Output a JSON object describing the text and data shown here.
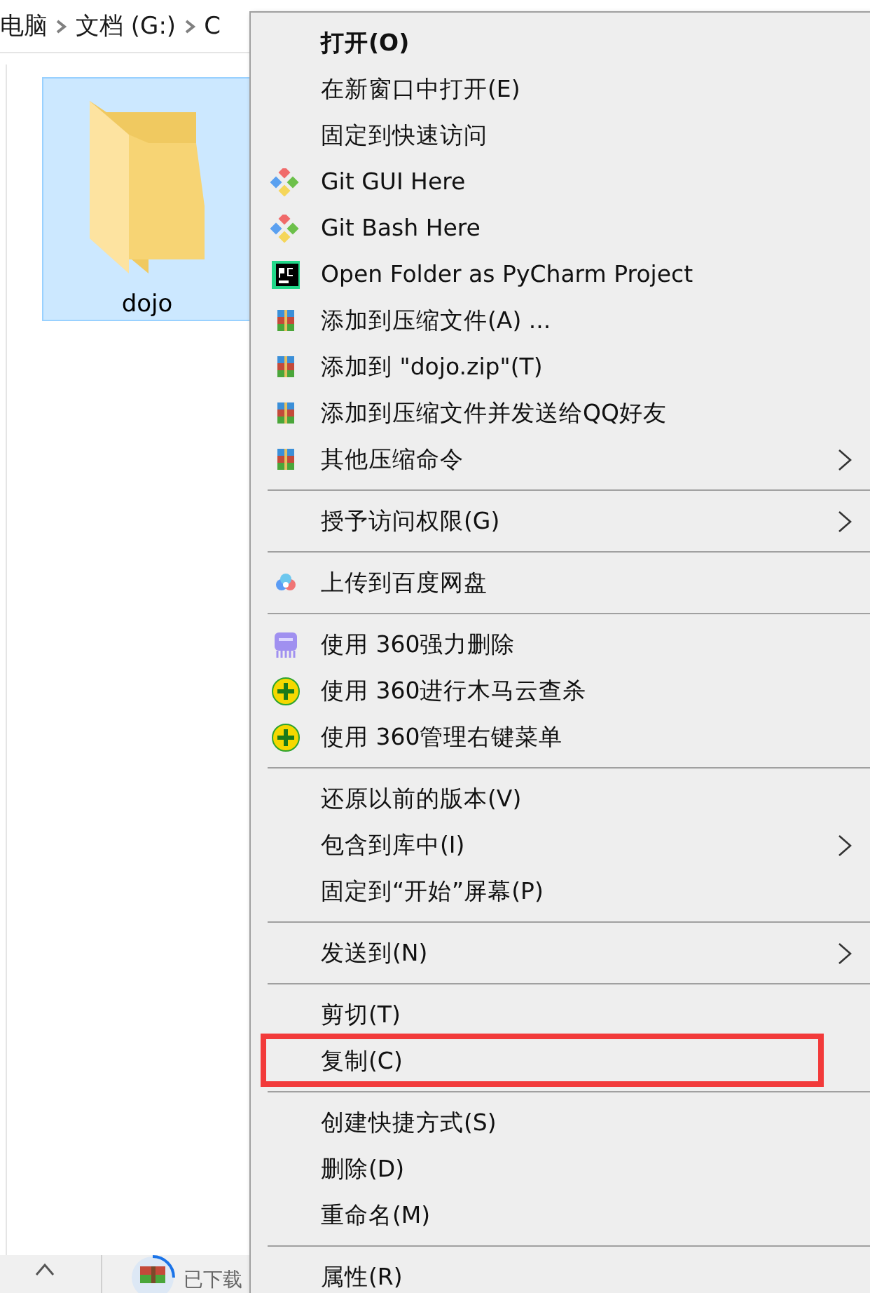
{
  "explorer": {
    "breadcrumb": [
      "电脑",
      "文档 (G:)",
      "C"
    ],
    "folder": {
      "name": "dojo",
      "selected": true
    }
  },
  "taskbar": {
    "download": {
      "status": "已下载"
    }
  },
  "menu": {
    "items": [
      {
        "kind": "plain",
        "label": "打开(O)",
        "bold": true
      },
      {
        "kind": "plain",
        "label": "在新窗口中打开(E)"
      },
      {
        "kind": "plain",
        "label": "固定到快速访问"
      },
      {
        "kind": "git",
        "label": "Git GUI Here"
      },
      {
        "kind": "git",
        "label": "Git Bash Here"
      },
      {
        "kind": "pycharm",
        "label": "Open Folder as PyCharm Project"
      },
      {
        "kind": "archive",
        "label": "添加到压缩文件(A) ..."
      },
      {
        "kind": "archive",
        "label": "添加到 \"dojo.zip\"(T)"
      },
      {
        "kind": "archive",
        "label": "添加到压缩文件并发送给QQ好友"
      },
      {
        "kind": "archive",
        "label": "其他压缩命令",
        "submenu": true
      },
      {
        "kind": "separator"
      },
      {
        "kind": "plain",
        "label": "授予访问权限(G)",
        "submenu": true
      },
      {
        "kind": "separator"
      },
      {
        "kind": "cloud",
        "label": "上传到百度网盘"
      },
      {
        "kind": "separator"
      },
      {
        "kind": "shredder",
        "label": "使用 360强力删除"
      },
      {
        "kind": "plus",
        "label": "使用 360进行木马云查杀"
      },
      {
        "kind": "plus",
        "label": "使用 360管理右键菜单"
      },
      {
        "kind": "separator"
      },
      {
        "kind": "plain",
        "label": "还原以前的版本(V)"
      },
      {
        "kind": "plain",
        "label": "包含到库中(I)",
        "submenu": true
      },
      {
        "kind": "plain",
        "label": "固定到“开始”屏幕(P)"
      },
      {
        "kind": "separator"
      },
      {
        "kind": "plain",
        "label": "发送到(N)",
        "submenu": true
      },
      {
        "kind": "separator"
      },
      {
        "kind": "plain",
        "label": "剪切(T)"
      },
      {
        "kind": "plain",
        "label": "复制(C)",
        "outlined": true
      },
      {
        "kind": "separator"
      },
      {
        "kind": "plain",
        "label": "创建快捷方式(S)"
      },
      {
        "kind": "plain",
        "label": "删除(D)"
      },
      {
        "kind": "plain",
        "label": "重命名(M)"
      },
      {
        "kind": "separator"
      },
      {
        "kind": "plain",
        "label": "属性(R)"
      }
    ]
  }
}
